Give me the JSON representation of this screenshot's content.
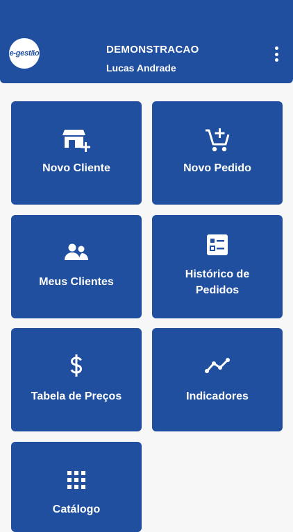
{
  "header": {
    "logo_text": "e-gestão",
    "company": "DEMONSTRACAO",
    "user": "Lucas Andrade",
    "menu_icon": "more-vertical-icon",
    "background": "#1f4f9e"
  },
  "tiles": [
    {
      "label": "Novo Cliente",
      "icon": "store-add-icon"
    },
    {
      "label": "Novo Pedido",
      "icon": "cart-add-icon"
    },
    {
      "label": "Meus Clientes",
      "icon": "people-icon"
    },
    {
      "label_line1": "Histórico de",
      "label_line2": "Pedidos",
      "icon": "list-box-icon"
    },
    {
      "label": "Tabela de Preços",
      "icon": "dollar-icon"
    },
    {
      "label": "Indicadores",
      "icon": "trend-line-icon"
    },
    {
      "label": "Catálogo",
      "icon": "grid-icon"
    }
  ],
  "colors": {
    "accent": "#1f4f9e",
    "background": "#f7f7f8",
    "text_on_accent": "#ffffff"
  }
}
